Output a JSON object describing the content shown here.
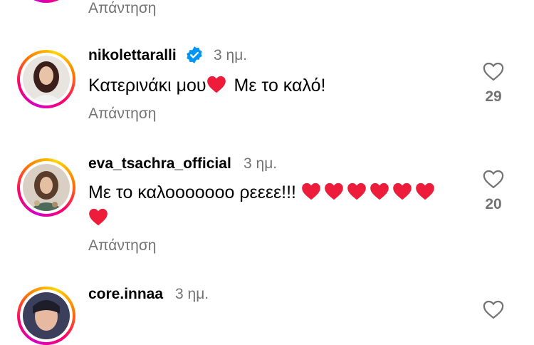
{
  "colors": {
    "heart_red": "#ed1c3a",
    "verified_blue": "#0095f6",
    "meta_gray": "#737373"
  },
  "reply_label": "Απάντηση",
  "comments": [
    {
      "username": "nikolettaralli",
      "verified": true,
      "time": "3 ημ.",
      "text_before": "Κατερινάκι μου",
      "text_after": " Με το καλό!",
      "hearts_inline": 1,
      "likes": "29"
    },
    {
      "username": "eva_tsachra_official",
      "verified": false,
      "time": "3 ημ.",
      "text_before": "Με το καλοοοοοοο ρεεεε!!! ",
      "hearts_count": 7,
      "likes": "20"
    },
    {
      "username": "core.innaa",
      "verified": false,
      "time": "3 ημ."
    }
  ],
  "icons": [
    "heart-outline-icon",
    "verified-badge-icon",
    "red-heart-emoji"
  ]
}
